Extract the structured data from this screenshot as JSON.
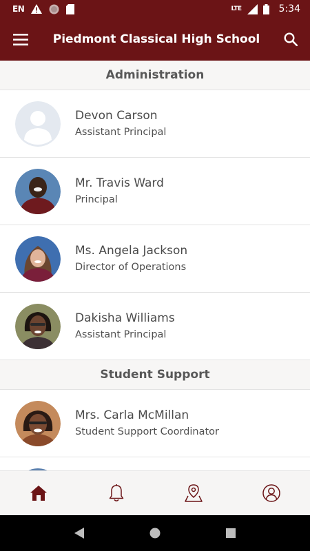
{
  "status_bar": {
    "left_text": "EN",
    "network": "LTE",
    "time": "5:34"
  },
  "app_bar": {
    "title": "Piedmont Classical High School",
    "menu_icon": "hamburger-menu-icon",
    "search_icon": "search-icon"
  },
  "sections": [
    {
      "title": "Administration",
      "people": [
        {
          "name": "Devon Carson",
          "role": "Assistant Principal"
        },
        {
          "name": "Mr. Travis Ward",
          "role": "Principal"
        },
        {
          "name": "Ms. Angela Jackson",
          "role": "Director of Operations"
        },
        {
          "name": "Dakisha Williams",
          "role": "Assistant Principal"
        }
      ]
    },
    {
      "title": "Student Support",
      "people": [
        {
          "name": "Mrs. Carla McMillan",
          "role": "Student Support Coordinator"
        }
      ]
    }
  ],
  "bottom_nav": [
    "home-icon",
    "bell-icon",
    "location-pin-icon",
    "profile-icon"
  ],
  "colors": {
    "brand": "#6b1416",
    "section_bg": "#f7f6f5",
    "text": "#4a4a4a"
  }
}
